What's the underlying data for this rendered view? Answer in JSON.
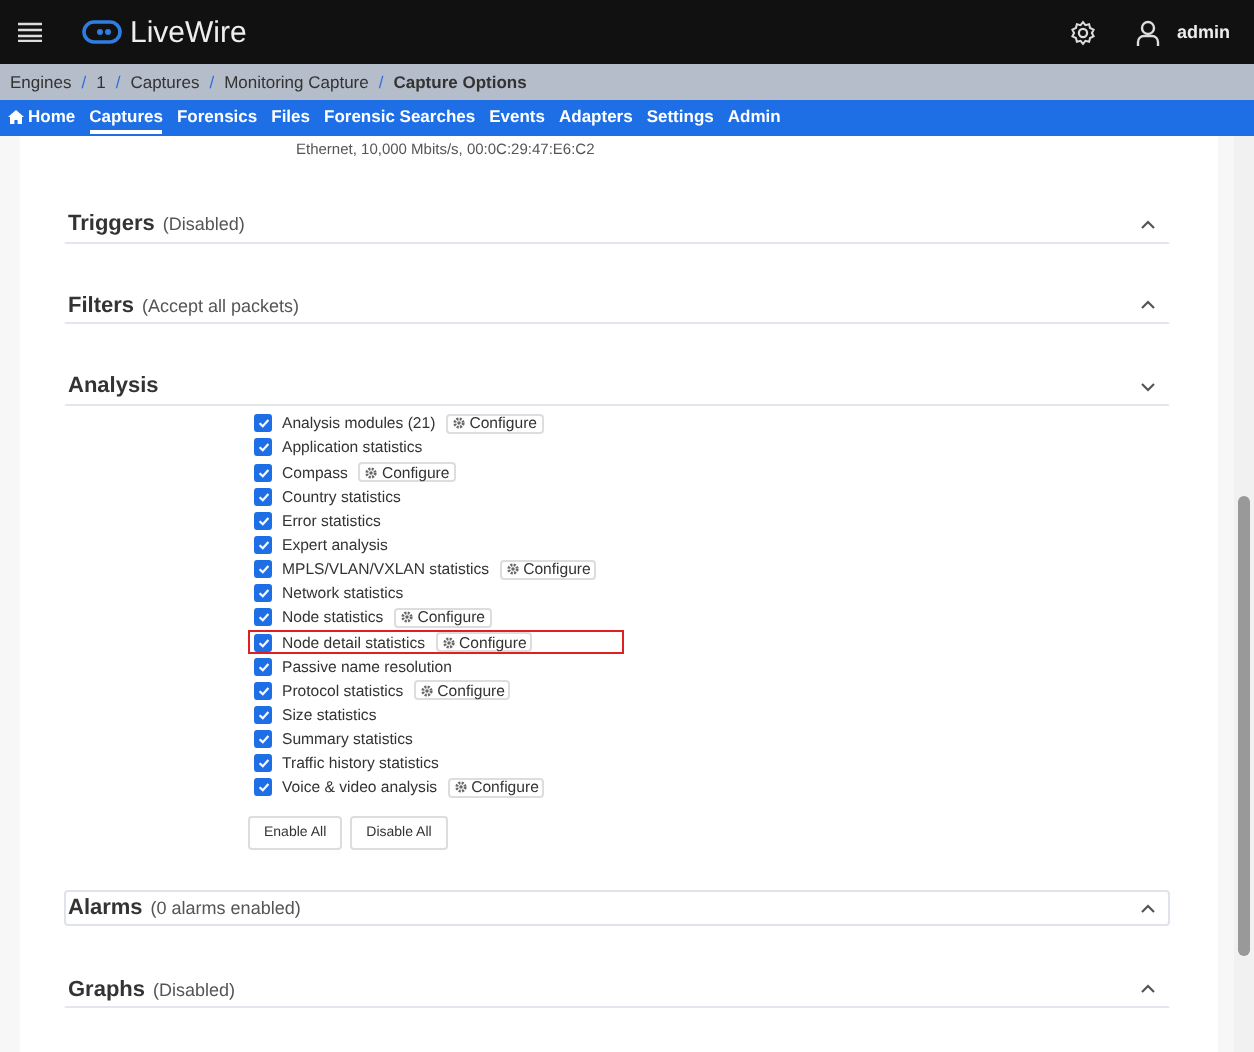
{
  "app": {
    "title": "LiveWire",
    "user": "admin"
  },
  "breadcrumb_separator": "/",
  "breadcrumb": [
    "Engines",
    "1",
    "Captures",
    "Monitoring Capture",
    "Capture Options"
  ],
  "nav": [
    {
      "label": "Home",
      "selected": false,
      "kind": "home"
    },
    {
      "label": "Captures",
      "selected": true
    },
    {
      "label": "Forensics",
      "selected": false
    },
    {
      "label": "Files",
      "selected": false
    },
    {
      "label": "Forensic Searches",
      "selected": false
    },
    {
      "label": "Events",
      "selected": false
    },
    {
      "label": "Adapters",
      "selected": false
    },
    {
      "label": "Settings",
      "selected": false
    },
    {
      "label": "Admin",
      "selected": false
    }
  ],
  "adapter_info": "Ethernet, 10,000 Mbits/s, 00:0C:29:47:E6:C2",
  "sections_before": [
    {
      "title": "Triggers",
      "note": "(Disabled)",
      "expanded": false,
      "focused": false
    },
    {
      "title": "Filters",
      "note": "(Accept all packets)",
      "expanded": false,
      "focused": false
    }
  ],
  "analysis": {
    "title": "Analysis",
    "expanded": true,
    "options": [
      {
        "label": "Analysis modules (21)",
        "checked": true,
        "configure": "Configure",
        "highlighted": false
      },
      {
        "label": "Application statistics",
        "checked": true,
        "highlighted": false
      },
      {
        "label": "Compass",
        "checked": true,
        "configure": "Configure",
        "highlighted": false
      },
      {
        "label": "Country statistics",
        "checked": true,
        "highlighted": false
      },
      {
        "label": "Error statistics",
        "checked": true,
        "highlighted": false
      },
      {
        "label": "Expert analysis",
        "checked": true,
        "highlighted": false
      },
      {
        "label": "MPLS/VLAN/VXLAN statistics",
        "checked": true,
        "configure": "Configure",
        "highlighted": false
      },
      {
        "label": "Network statistics",
        "checked": true,
        "highlighted": false
      },
      {
        "label": "Node statistics",
        "checked": true,
        "configure": "Configure",
        "highlighted": false
      },
      {
        "label": "Node detail statistics",
        "checked": true,
        "configure": "Configure",
        "highlighted": true
      },
      {
        "label": "Passive name resolution",
        "checked": true,
        "highlighted": false
      },
      {
        "label": "Protocol statistics",
        "checked": true,
        "configure": "Configure",
        "highlighted": false
      },
      {
        "label": "Size statistics",
        "checked": true,
        "highlighted": false
      },
      {
        "label": "Summary statistics",
        "checked": true,
        "highlighted": false
      },
      {
        "label": "Traffic history statistics",
        "checked": true,
        "highlighted": false
      },
      {
        "label": "Voice & video analysis",
        "checked": true,
        "configure": "Configure",
        "highlighted": false
      }
    ],
    "buttons": [
      "Enable All",
      "Disable All"
    ]
  },
  "sections_after": [
    {
      "title": "Alarms",
      "note": "(0 alarms enabled)",
      "expanded": false,
      "focused": true
    },
    {
      "title": "Graphs",
      "note": "(Disabled)",
      "expanded": false,
      "focused": false
    }
  ]
}
